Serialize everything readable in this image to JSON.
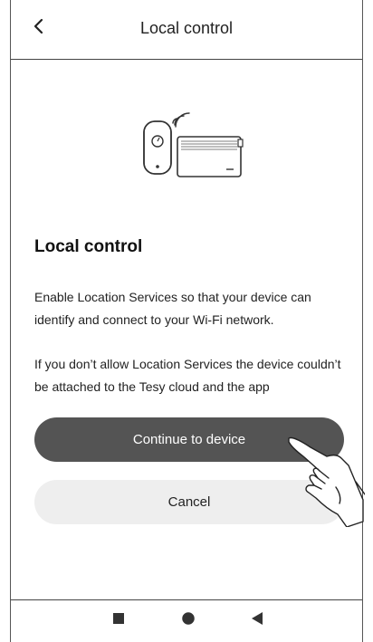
{
  "header": {
    "title": "Local control",
    "back_icon": "chevron-left-icon"
  },
  "illustration": {
    "icons": [
      "wifi-router-icon",
      "wifi-signal-icon",
      "heater-device-icon"
    ]
  },
  "content": {
    "title": "Local control",
    "paragraph_1": "Enable Location Services so that your device can identify and connect to your Wi-Fi network.",
    "paragraph_2": "If you don’t allow Location Services the device couldn’t be attached to the Tesy cloud and the app"
  },
  "buttons": {
    "primary_label": "Continue to device",
    "secondary_label": "Cancel"
  },
  "nav_bar": {
    "icons": [
      "square-recents-icon",
      "circle-home-icon",
      "triangle-back-icon"
    ]
  },
  "colors": {
    "primary_button": "#545454",
    "secondary_button": "#eeeeee",
    "border": "#444444"
  }
}
